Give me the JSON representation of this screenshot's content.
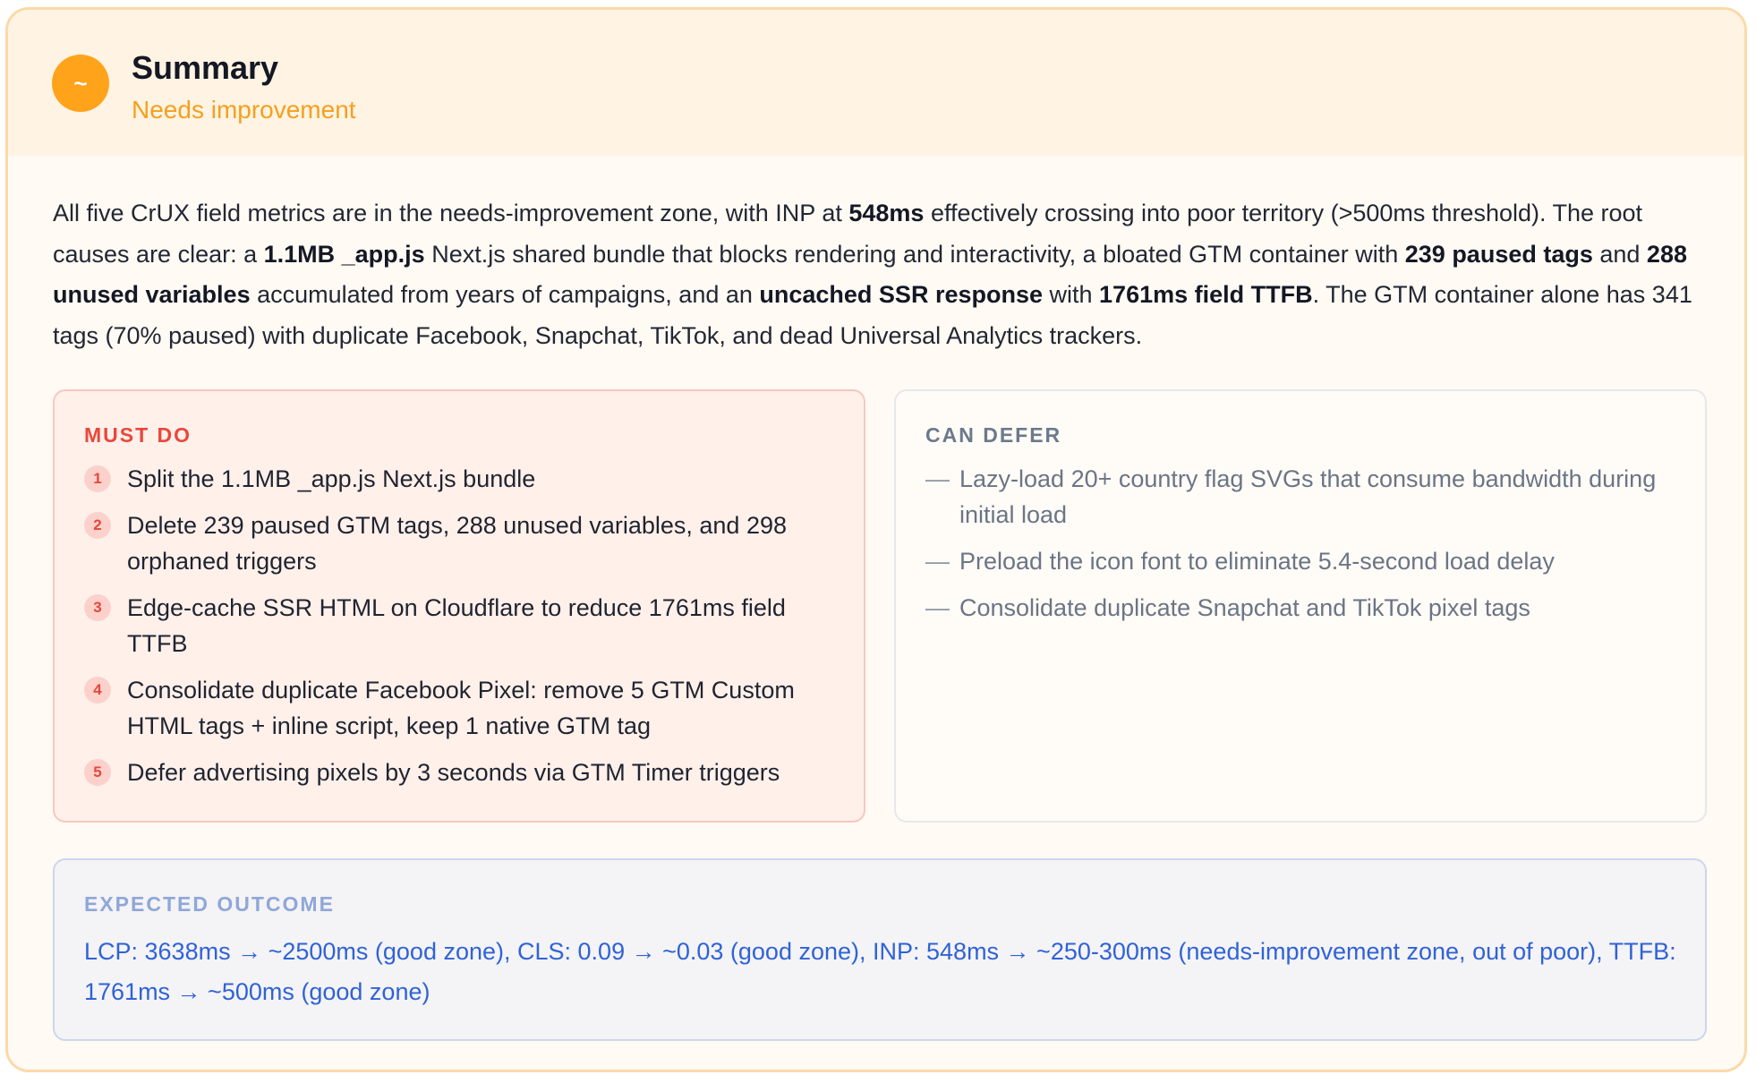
{
  "header": {
    "icon_glyph": "~",
    "title": "Summary",
    "status": "Needs improvement",
    "status_color": "#f5a01d"
  },
  "summary": {
    "p1": "All five CrUX field metrics are in the needs-improvement zone, with INP at ",
    "b1": "548ms",
    "p2": " effectively crossing into poor territory (>500ms threshold). The root causes are clear: a ",
    "b2": "1.1MB _app.js",
    "p3": " Next.js shared bundle that blocks rendering and interactivity, a bloated GTM container with ",
    "b3": "239 paused tags",
    "p4": " and ",
    "b4": "288 unused variables",
    "p5": " accumulated from years of campaigns, and an ",
    "b5": "uncached SSR response",
    "p6": " with ",
    "b6": "1761ms field TTFB",
    "p7": ". The GTM container alone has 341 tags (70% paused) with duplicate Facebook, Snapchat, TikTok, and dead Universal Analytics trackers."
  },
  "must_do": {
    "label": "MUST DO",
    "items": [
      {
        "num": "1",
        "text": "Split the 1.1MB _app.js Next.js bundle"
      },
      {
        "num": "2",
        "text": "Delete 239 paused GTM tags, 288 unused variables, and 298 orphaned triggers"
      },
      {
        "num": "3",
        "text": "Edge-cache SSR HTML on Cloudflare to reduce 1761ms field TTFB"
      },
      {
        "num": "4",
        "text": "Consolidate duplicate Facebook Pixel: remove 5 GTM Custom HTML tags + inline script, keep 1 native GTM tag"
      },
      {
        "num": "5",
        "text": "Defer advertising pixels by 3 seconds via GTM Timer triggers"
      }
    ]
  },
  "can_defer": {
    "label": "CAN DEFER",
    "dash": "—",
    "items": [
      "Lazy-load 20+ country flag SVGs that consume bandwidth during initial load",
      "Preload the icon font to eliminate 5.4-second load delay",
      "Consolidate duplicate Snapchat and TikTok pixel tags"
    ]
  },
  "expected_outcome": {
    "label": "EXPECTED OUTCOME",
    "text": "LCP: 3638ms → ~2500ms (good zone), CLS: 0.09 → ~0.03 (good zone), INP: 548ms → ~250-300ms (needs-improvement zone, out of poor), TTFB: 1761ms → ~500ms (good zone)"
  }
}
